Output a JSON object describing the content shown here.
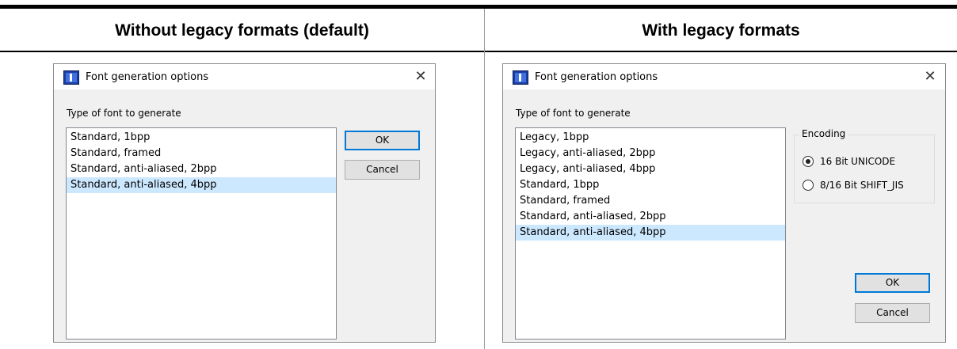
{
  "columns": {
    "left_header": "Without legacy formats (default)",
    "right_header": "With legacy formats"
  },
  "dialog_left": {
    "title": "Font generation options",
    "close_glyph": "✕",
    "list_caption": "Type of font to generate",
    "items": [
      "Standard, 1bpp",
      "Standard, framed",
      "Standard, anti-aliased, 2bpp",
      "Standard, anti-aliased, 4bpp"
    ],
    "selected_index": 3,
    "ok_label": "OK",
    "cancel_label": "Cancel"
  },
  "dialog_right": {
    "title": "Font generation options",
    "close_glyph": "✕",
    "list_caption": "Type of font to generate",
    "items": [
      "Legacy, 1bpp",
      "Legacy, anti-aliased, 2bpp",
      "Legacy, anti-aliased, 4bpp",
      "Standard, 1bpp",
      "Standard, framed",
      "Standard, anti-aliased, 2bpp",
      "Standard, anti-aliased, 4bpp"
    ],
    "selected_index": 6,
    "encoding_label": "Encoding",
    "radio_options": [
      "16 Bit UNICODE",
      "8/16 Bit SHIFT_JIS"
    ],
    "radio_selected": 0,
    "ok_label": "OK",
    "cancel_label": "Cancel"
  },
  "icons": {
    "app": "app-icon",
    "close": "close-icon"
  }
}
